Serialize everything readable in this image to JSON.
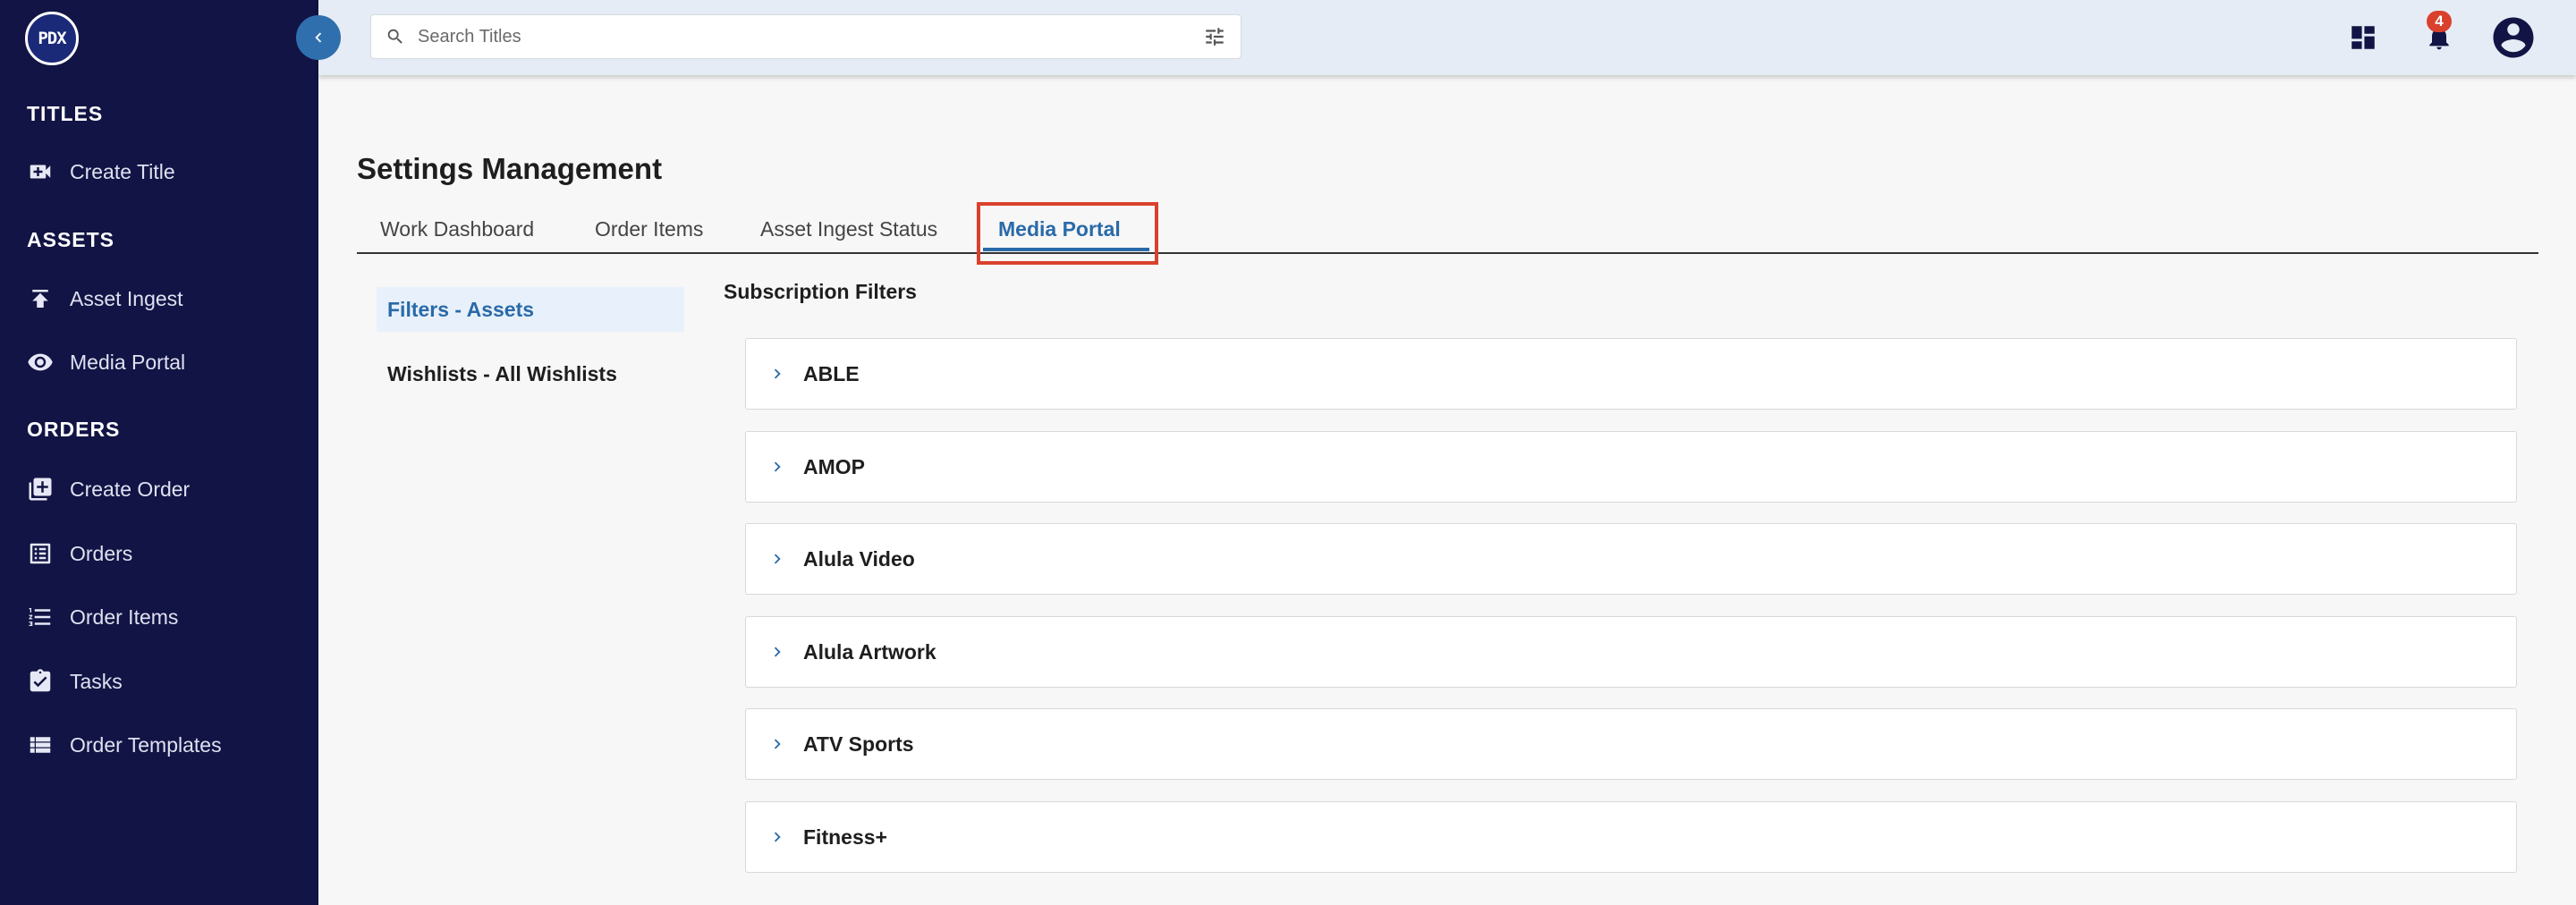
{
  "logo": {
    "text": "PDX"
  },
  "sidebar": {
    "sections": [
      {
        "header": "TITLES",
        "items": [
          {
            "label": "Create Title",
            "icon": "video-plus-icon"
          }
        ]
      },
      {
        "header": "ASSETS",
        "items": [
          {
            "label": "Asset Ingest",
            "icon": "upload-icon"
          },
          {
            "label": "Media Portal",
            "icon": "eye-icon"
          }
        ]
      },
      {
        "header": "ORDERS",
        "items": [
          {
            "label": "Create Order",
            "icon": "add-box-icon"
          },
          {
            "label": "Orders",
            "icon": "list-alt-icon"
          },
          {
            "label": "Order Items",
            "icon": "format-list-icon"
          },
          {
            "label": "Tasks",
            "icon": "clipboard-check-icon"
          },
          {
            "label": "Order Templates",
            "icon": "view-list-icon"
          }
        ]
      }
    ]
  },
  "topbar": {
    "search_placeholder": "Search Titles",
    "notification_count": "4"
  },
  "page": {
    "title": "Settings Management",
    "tabs": [
      {
        "label": "Work Dashboard",
        "active": false
      },
      {
        "label": "Order Items",
        "active": false
      },
      {
        "label": "Asset Ingest Status",
        "active": false
      },
      {
        "label": "Media Portal",
        "active": true
      }
    ],
    "subnav": [
      {
        "label": "Filters - Assets",
        "active": true
      },
      {
        "label": "Wishlists - All Wishlists",
        "active": false
      }
    ],
    "section_label": "Subscription Filters",
    "filters": [
      {
        "label": "ABLE"
      },
      {
        "label": "AMOP"
      },
      {
        "label": "Alula Video"
      },
      {
        "label": "Alula Artwork"
      },
      {
        "label": "ATV Sports"
      },
      {
        "label": "Fitness+"
      }
    ]
  },
  "colors": {
    "sidebar_bg": "#121445",
    "accent": "#2a6aa8",
    "highlight": "#d9412d",
    "topbar_bg": "#e6ecf5"
  }
}
